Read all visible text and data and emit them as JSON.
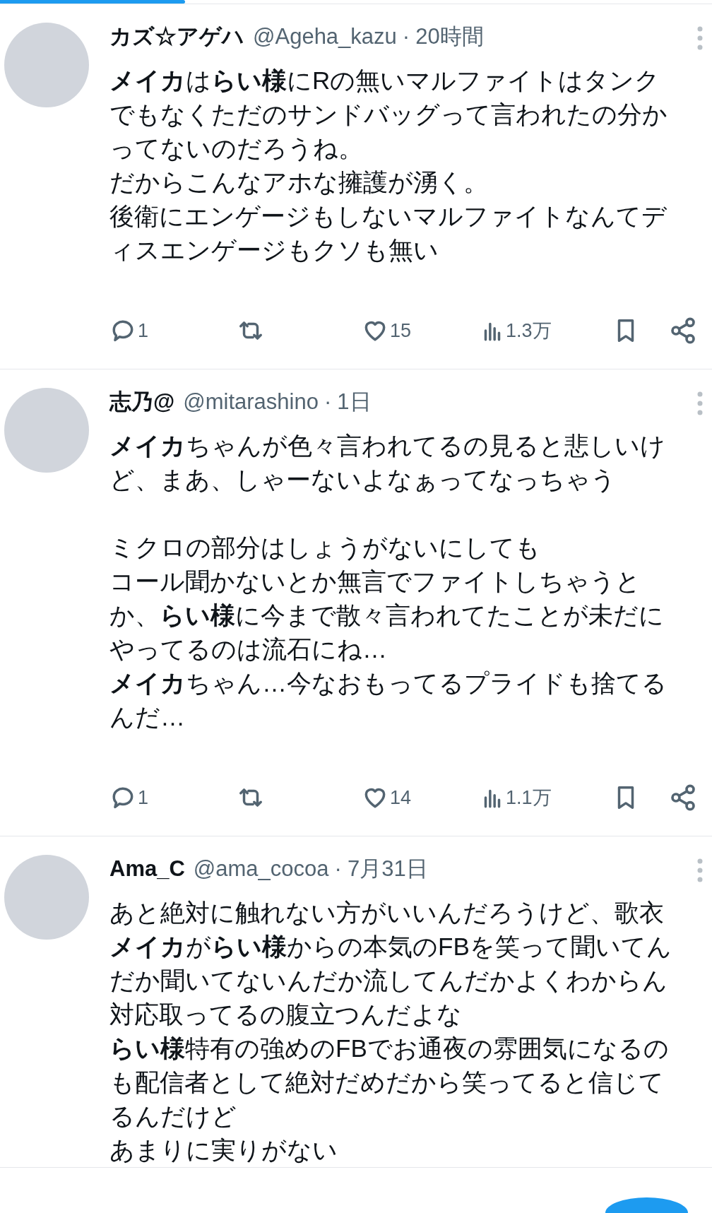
{
  "progress": {
    "level": 0.26
  },
  "tweets": [
    {
      "name": "カズ☆アゲハ",
      "handle": "@Ageha_kazu",
      "separator": "·",
      "time": "20時間",
      "paragraphs": [
        [
          "**メイカ**は**らい様**にRの無いマルファイトはタンク",
          "でもなくただのサンドバッグって言われたの分か",
          "ってないのだろうね。",
          "だからこんなアホな擁護が湧く。",
          "後衛にエンゲージもしないマルファイトなんてデ",
          "ィスエンゲージもクソも無い"
        ]
      ],
      "reply_count": "1",
      "like_count": "15",
      "view_count": "1.3万"
    },
    {
      "name": "志乃@",
      "handle": "@mitarashino",
      "separator": "·",
      "time": "1日",
      "paragraphs": [
        [
          "**メイカ**ちゃんが色々言われてるの見ると悲しいけ",
          "ど、まあ、しゃーないよなぁってなっちゃう"
        ],
        [
          "ミクロの部分はしょうがないにしても",
          "コール聞かないとか無言でファイトしちゃうと",
          "か、**らい様**に今まで散々言われてたことが未だに",
          "やってるのは流石にね…",
          "**メイカ**ちゃん…今なおもってるプライドも捨てる",
          "んだ…"
        ]
      ],
      "reply_count": "1",
      "like_count": "14",
      "view_count": "1.1万"
    },
    {
      "name": "Ama_C",
      "handle": "@ama_cocoa",
      "separator": "·",
      "time": "7月31日",
      "paragraphs": [
        [
          "あと絶対に触れない方がいいんだろうけど、歌衣",
          "**メイカ**が**らい様**からの本気のFBを笑って聞いてん",
          "だか聞いてないんだか流してんだかよくわからん",
          "対応取ってるの腹立つんだよな",
          "**らい様**特有の強めのFBでお通夜の雰囲気になるの",
          "も配信者として絶対だめだから笑ってると信じて",
          "るんだけど",
          "あまりに実りがない"
        ]
      ]
    }
  ]
}
